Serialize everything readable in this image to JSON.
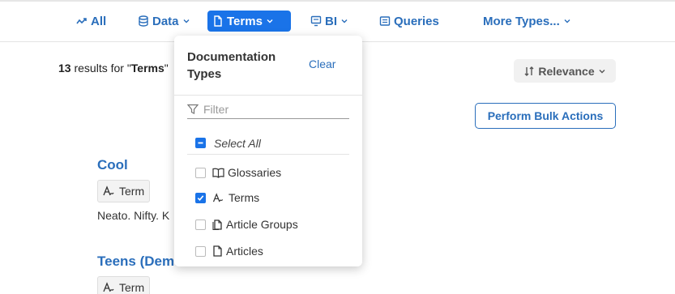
{
  "type_tabs": [
    {
      "label": "All",
      "icon": "trend-icon"
    },
    {
      "label": "Data",
      "icon": "database-icon"
    },
    {
      "label": "Terms",
      "icon": "document-icon"
    },
    {
      "label": "BI",
      "icon": "dashboard-icon"
    },
    {
      "label": "Queries",
      "icon": "queries-icon"
    },
    {
      "label": "More Types...",
      "icon": "chevron-down-icon"
    }
  ],
  "results": {
    "count": "13",
    "prefix": " results for \"",
    "query": "Terms",
    "suffix": "\""
  },
  "sort": {
    "label": "Relevance"
  },
  "bulk_actions": {
    "label": "Perform Bulk Actions"
  },
  "result_items": [
    {
      "title": "Cool",
      "tag": "Term",
      "description": "Neato. Nifty. K"
    },
    {
      "title": "Teens (Dem",
      "tag": "Term"
    }
  ],
  "dropdown": {
    "heading": "Documentation Types",
    "clear_label": "Clear",
    "filter_placeholder": "Filter",
    "select_all_label": "Select All",
    "options": [
      {
        "label": "Glossaries",
        "icon": "book-icon",
        "checked": false
      },
      {
        "label": "Terms",
        "icon": "term-icon",
        "checked": true
      },
      {
        "label": "Article Groups",
        "icon": "article-group-icon",
        "checked": false
      },
      {
        "label": "Articles",
        "icon": "article-icon",
        "checked": false
      }
    ]
  },
  "colors": {
    "accent": "#1a73e8",
    "link": "#2a6ebb"
  }
}
